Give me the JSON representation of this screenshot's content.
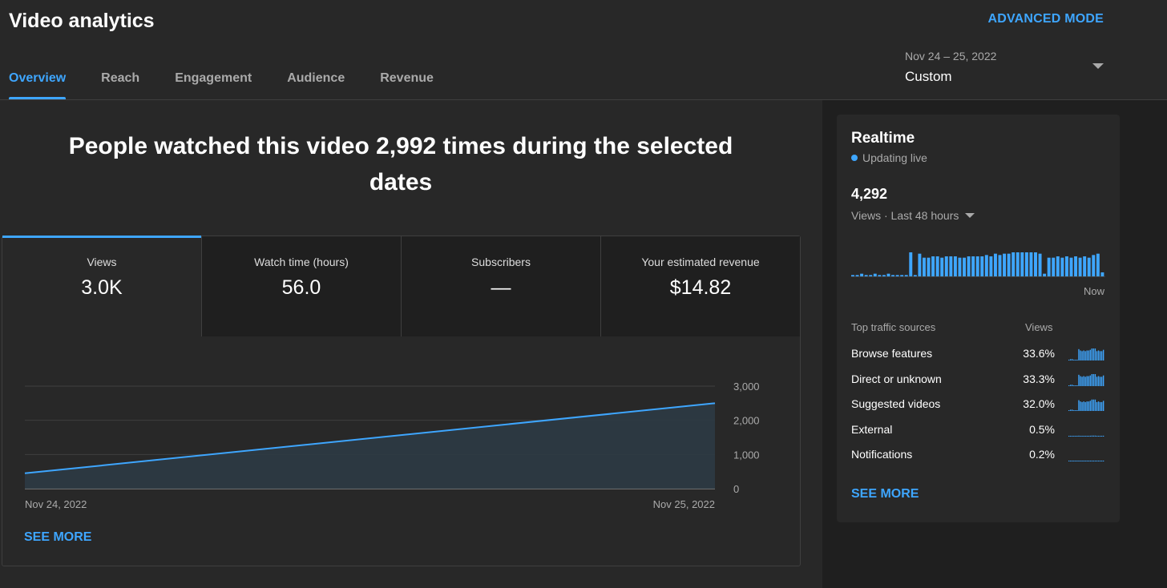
{
  "header": {
    "title": "Video analytics",
    "advanced_mode": "ADVANCED MODE",
    "date_range": "Nov 24 – 25, 2022",
    "date_mode": "Custom"
  },
  "tabs": [
    {
      "label": "Overview",
      "active": true
    },
    {
      "label": "Reach",
      "active": false
    },
    {
      "label": "Engagement",
      "active": false
    },
    {
      "label": "Audience",
      "active": false
    },
    {
      "label": "Revenue",
      "active": false
    }
  ],
  "headline": "People watched this video 2,992 times during the selected dates",
  "metrics": [
    {
      "label": "Views",
      "value": "3.0K",
      "active": true
    },
    {
      "label": "Watch time (hours)",
      "value": "56.0",
      "active": false
    },
    {
      "label": "Subscribers",
      "value": "—",
      "active": false
    },
    {
      "label": "Your estimated revenue",
      "value": "$14.82",
      "active": false
    }
  ],
  "chart_data": {
    "type": "area",
    "title": "",
    "x": [
      "Nov 24, 2022",
      "Nov 25, 2022"
    ],
    "series": [
      {
        "values": [
          450,
          2500
        ]
      }
    ],
    "y_ticks": [
      "3,000",
      "2,000",
      "1,000",
      "0"
    ],
    "ylim": [
      0,
      3000
    ],
    "grid": true,
    "colors": {
      "line": "#3ea6ff",
      "fill": "#2c3a44"
    }
  },
  "see_more_label": "SEE MORE",
  "realtime": {
    "title": "Realtime",
    "live_label": "Updating live",
    "count": "4,292",
    "period": "Views · Last 48 hours",
    "now_label": "Now",
    "bars": [
      1,
      1,
      2,
      1,
      1,
      2,
      1,
      1,
      2,
      1,
      1,
      1,
      1,
      18,
      1,
      17,
      14,
      14,
      15,
      15,
      14,
      15,
      15,
      15,
      14,
      14,
      15,
      15,
      15,
      15,
      16,
      15,
      17,
      16,
      17,
      17,
      18,
      18,
      18,
      18,
      18,
      18,
      17,
      2,
      14,
      14,
      15,
      14,
      15,
      14,
      15,
      14,
      15,
      14,
      16,
      17,
      3
    ],
    "color": "#3ea6ff",
    "traffic_header": "Top traffic sources",
    "traffic_views_header": "Views",
    "traffic_sources": [
      {
        "name": "Browse features",
        "pct": "33.6%",
        "level": 1.0
      },
      {
        "name": "Direct or unknown",
        "pct": "33.3%",
        "level": 1.0
      },
      {
        "name": "Suggested videos",
        "pct": "32.0%",
        "level": 0.95
      },
      {
        "name": "External",
        "pct": "0.5%",
        "level": 0.08
      },
      {
        "name": "Notifications",
        "pct": "0.2%",
        "level": 0.04
      }
    ],
    "see_more_label": "SEE MORE"
  }
}
